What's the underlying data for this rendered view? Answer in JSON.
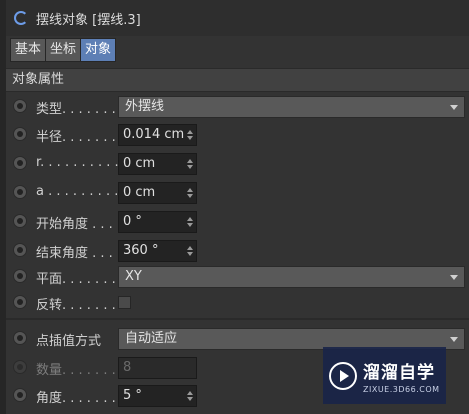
{
  "header": {
    "title": "摆线对象 [摆线.3]",
    "icon": "cycloid-spin-icon"
  },
  "tabs": [
    {
      "label": "基本",
      "active": false
    },
    {
      "label": "坐标",
      "active": false
    },
    {
      "label": "对象",
      "active": true
    }
  ],
  "section": {
    "title": "对象属性"
  },
  "fields": {
    "type": {
      "label": "类型. . . . . . . .",
      "value": "外摆线"
    },
    "radius": {
      "label": "半径. . . . . . . .",
      "value": "0.014 cm"
    },
    "r": {
      "label": "r. . . . . . . . . . .",
      "value": "0 cm"
    },
    "a": {
      "label": "a  . . . . . . . . . .",
      "value": "0 cm"
    },
    "start_angle": {
      "label": "开始角度 . . .",
      "value": "0 °"
    },
    "end_angle": {
      "label": "结束角度 . . .",
      "value": "360 °"
    },
    "plane": {
      "label": "平面. . . . . . . .",
      "value": "XY"
    },
    "reverse": {
      "label": "反转. . . . . . .",
      "checked": false
    },
    "interp": {
      "label": "点插值方式",
      "value": "自动适应"
    },
    "count": {
      "label": "数量. . . . . . . .",
      "value": "8"
    },
    "angle": {
      "label": "角度. . . . . . . .",
      "value": "5 °"
    }
  },
  "watermark": {
    "name": "溜溜自学",
    "url": "ZIXUE.3D66.COM"
  },
  "colors": {
    "accent": "#5d7fb5",
    "background": "#333333"
  }
}
